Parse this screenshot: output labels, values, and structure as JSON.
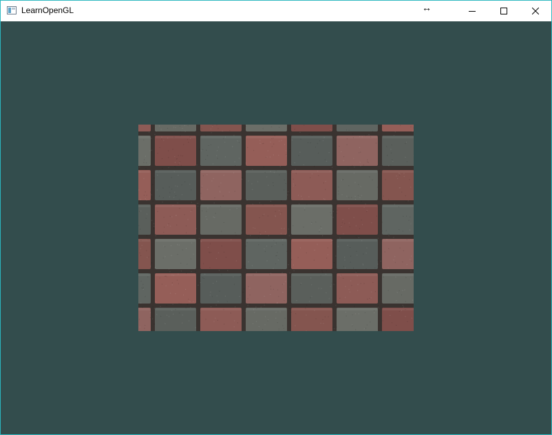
{
  "window": {
    "title": "LearnOpenGL",
    "icon": "app-window-icon",
    "controls": {
      "minimize_icon": "minimize-icon",
      "maximize_icon": "maximize-icon",
      "close_icon": "close-icon"
    },
    "cursor_glyph": "↔"
  },
  "scene": {
    "clear_color": "#334d4d",
    "texture": "brick-pavement-checker",
    "tile_colors": {
      "red": "#8a5a55",
      "gray": "#5e6460",
      "mortar": "#3a3330"
    }
  }
}
